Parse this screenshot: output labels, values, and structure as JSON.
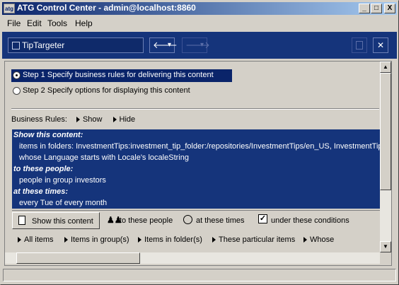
{
  "window": {
    "title": "ATG Control Center - admin@localhost:8860",
    "app_icon_text": "atg",
    "controls": [
      "_",
      "□",
      "X"
    ]
  },
  "menu": [
    "File",
    "Edit",
    "Tools",
    "Help"
  ],
  "toolbar": {
    "document_name": "TipTargeter",
    "back_icon": "back-arrow-icon",
    "forward_icon": "forward-arrow-icon",
    "dropdown_glyph": "▾",
    "back_glyph": "🡐",
    "forward_glyph": "🡒",
    "save_icon": "save-icon",
    "close_glyph": "✕"
  },
  "steps": [
    {
      "label": "Step 1  Specify business rules for delivering this content",
      "selected": true
    },
    {
      "label": "Step 2  Specify options for displaying this content",
      "selected": false
    }
  ],
  "business_rules": {
    "label": "Business Rules:",
    "show_label": "Show",
    "hide_label": "Hide"
  },
  "rules": [
    {
      "kind": "head",
      "text": "Show this content:"
    },
    {
      "kind": "body",
      "text": "items in folders: InvestmentTips:investment_tip_folder:/repositories/InvestmentTips/en_US, InvestmentTips:"
    },
    {
      "kind": "body",
      "text": "whose Language starts with Locale's localeString"
    },
    {
      "kind": "head",
      "text": "to these people:"
    },
    {
      "kind": "body",
      "text": "people in group investors"
    },
    {
      "kind": "head",
      "text": "at these times:"
    },
    {
      "kind": "body",
      "text": "every Tue of every month"
    }
  ],
  "tabs": [
    {
      "label": "Show this content",
      "icon": "document-icon",
      "selected": true
    },
    {
      "label": "to these people",
      "icon": "people-icon",
      "selected": false
    },
    {
      "label": "at these times",
      "icon": "clock-icon",
      "selected": false
    },
    {
      "label": "under these conditions",
      "icon": "checkbox-icon",
      "selected": false
    }
  ],
  "options": [
    "All items",
    "Items in group(s)",
    "Items in folder(s)",
    "These particular items",
    "Whose"
  ],
  "colors": {
    "title_start": "#0a246a",
    "title_end": "#a6caf0",
    "toolbar": "#15347b",
    "selection": "#0a246a",
    "panel": "#d4d0c8"
  }
}
